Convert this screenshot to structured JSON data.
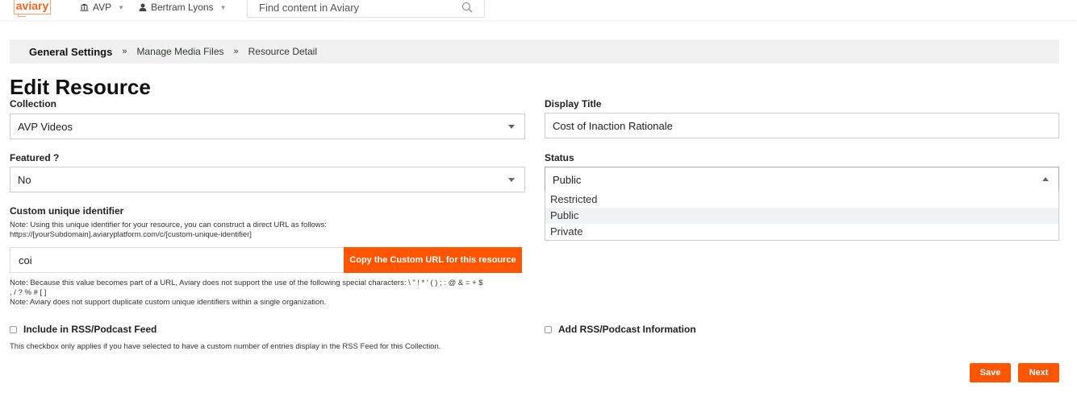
{
  "nav": {
    "logo": "aviary",
    "org": "AVP",
    "user": "Bertram Lyons",
    "search_placeholder": "Find content in Aviary"
  },
  "breadcrumb": [
    "General Settings",
    "Manage Media Files",
    "Resource Detail"
  ],
  "breadcrumb_sep": "»",
  "page_title": "Edit Resource",
  "form": {
    "collection": {
      "label": "Collection",
      "value": "AVP Videos"
    },
    "display_title": {
      "label": "Display Title",
      "value": "Cost of Inaction Rationale"
    },
    "featured": {
      "label": "Featured ?",
      "value": "No"
    },
    "status": {
      "label": "Status",
      "value": "Public",
      "options": [
        "Restricted",
        "Public",
        "Private"
      ]
    },
    "custom_id": {
      "label": "Custom unique identifier",
      "note_line1": "Note: Using this unique identifier for your resource, you can construct a direct URL as follows:",
      "note_line2": "https://[yourSubdomain].aviaryplatform.com/c/[custom-unique-identifier]",
      "value": "coi",
      "copy_button": "Copy the Custom URL for this resource",
      "note2_line1": "Note: Because this value becomes part of a URL, Aviary does not support the use of the following special characters: \\ \" ! * ' ( ) ; : @ & = + $",
      "note2_line2": ", / ? % # [ ]",
      "note3": "Note: Aviary does not support duplicate custom unique identifiers within a single organization."
    },
    "rss": {
      "label": "Include in RSS/Podcast Feed",
      "note": "This checkbox only applies if you have selected to have a custom number of entries display in the RSS Feed for this Collection."
    },
    "rss_info": {
      "label": "Add RSS/Podcast Information"
    }
  },
  "buttons": {
    "save": "Save",
    "next": "Next"
  },
  "colors": {
    "accent": "#ff5500"
  }
}
